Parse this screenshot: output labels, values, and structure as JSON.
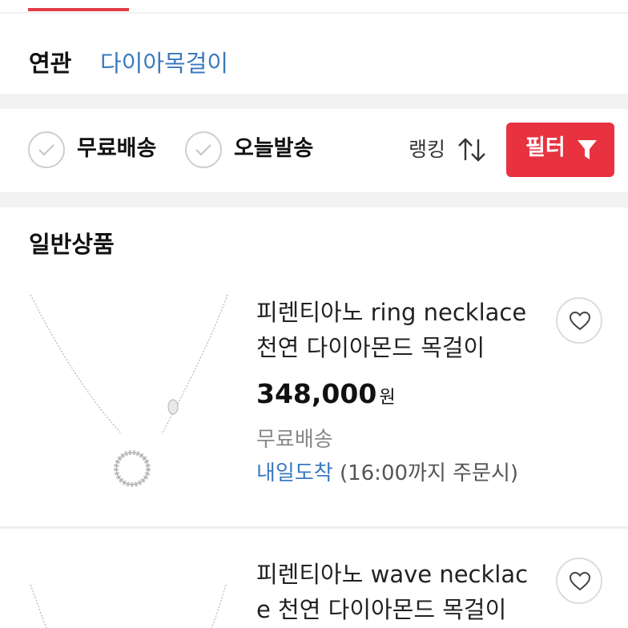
{
  "related": {
    "label": "연관",
    "keyword": "다이아목걸이"
  },
  "filters": {
    "free_shipping": "무료배송",
    "today_shipping": "오늘발송",
    "ranking": "랭킹",
    "filter_button": "필터"
  },
  "section": {
    "title": "일반상품"
  },
  "products": [
    {
      "title_line1": "피렌티아노 ring necklace",
      "title_line2": "천연 다이아몬드 목걸이",
      "price": "348,000",
      "price_unit": "원",
      "shipping": "무료배송",
      "arrival": "내일도착",
      "arrival_note": "(16:00까지 주문시)"
    },
    {
      "title_line1": "피렌티아노 wave necklac",
      "title_line2": "e 천연 다이아몬드 목걸이"
    }
  ],
  "colors": {
    "accent": "#e8323f",
    "link": "#3a7abf"
  }
}
